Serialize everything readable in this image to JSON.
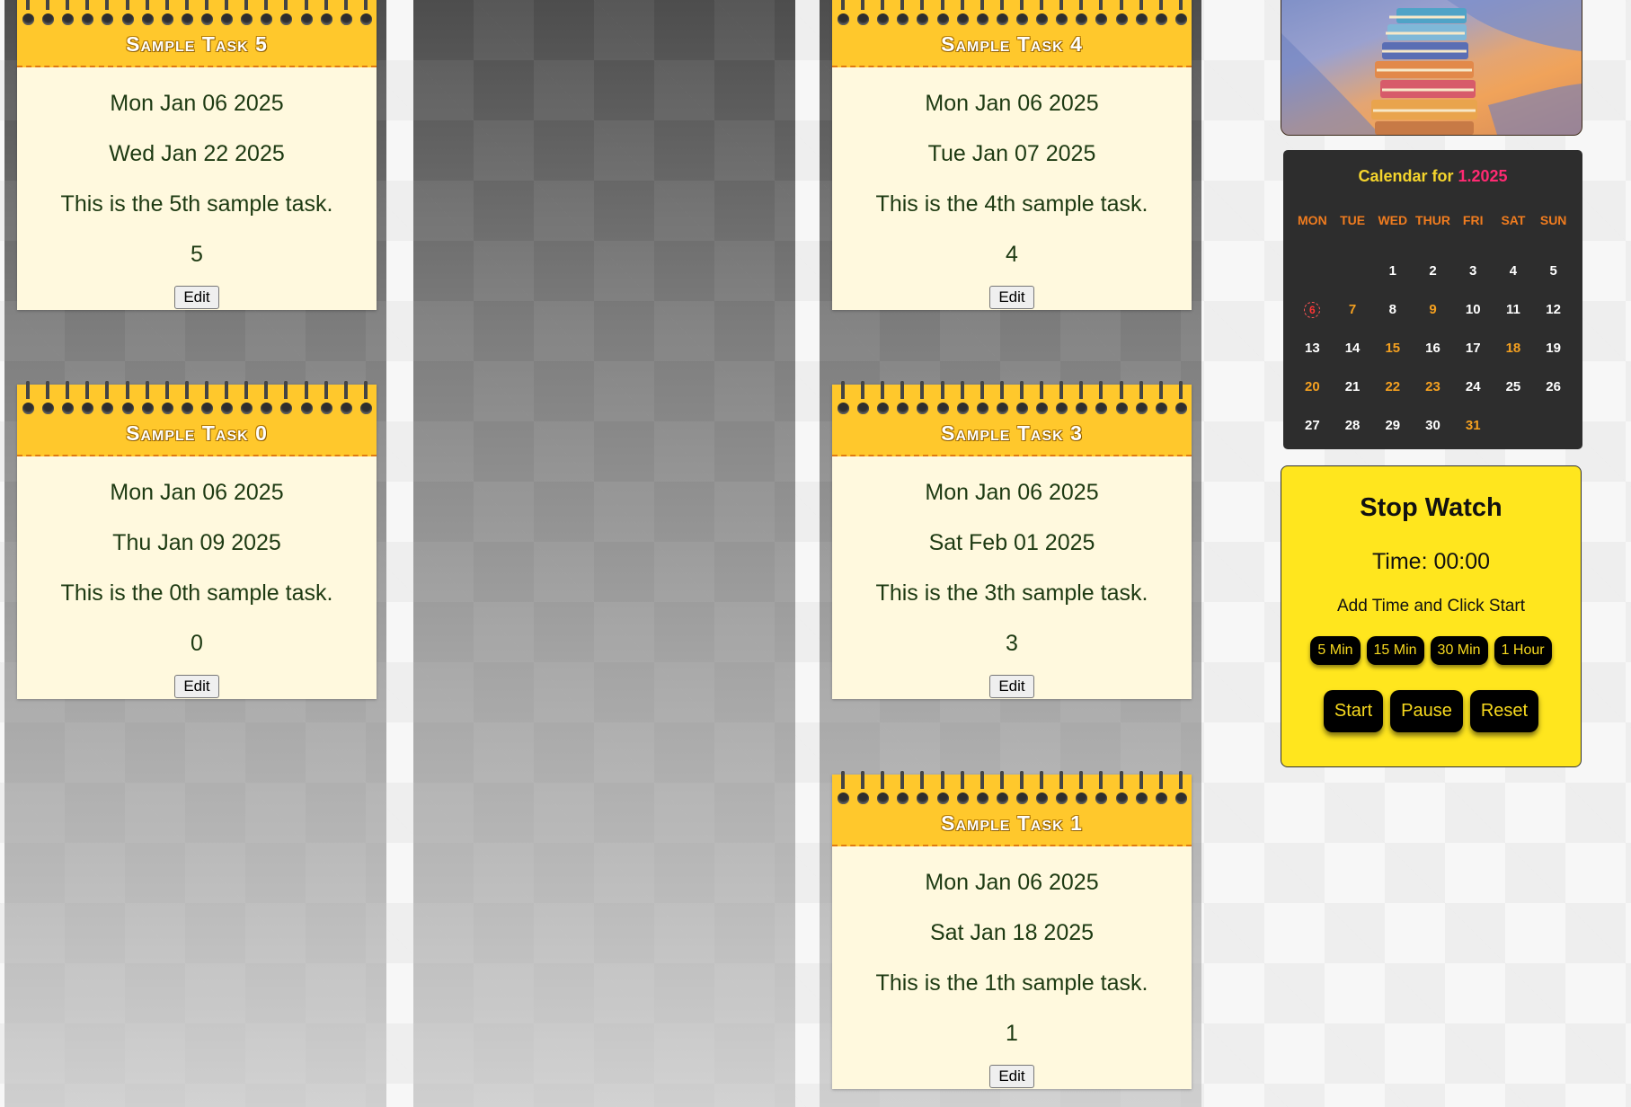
{
  "columns": {
    "left": {
      "tasks": [
        {
          "title": "Sample Task 5",
          "start": "Mon Jan 06 2025",
          "due": "Wed Jan 22 2025",
          "description": "This is the 5th sample task.",
          "number": "5",
          "edit_label": "Edit"
        },
        {
          "title": "Sample Task 0",
          "start": "Mon Jan 06 2025",
          "due": "Thu Jan 09 2025",
          "description": "This is the 0th sample task.",
          "number": "0",
          "edit_label": "Edit"
        }
      ]
    },
    "middle": {
      "tasks": []
    },
    "right": {
      "tasks": [
        {
          "title": "Sample Task 4",
          "start": "Mon Jan 06 2025",
          "due": "Tue Jan 07 2025",
          "description": "This is the 4th sample task.",
          "number": "4",
          "edit_label": "Edit"
        },
        {
          "title": "Sample Task 3",
          "start": "Mon Jan 06 2025",
          "due": "Sat Feb 01 2025",
          "description": "This is the 3th sample task.",
          "number": "3",
          "edit_label": "Edit"
        },
        {
          "title": "Sample Task 1",
          "start": "Mon Jan 06 2025",
          "due": "Sat Jan 18 2025",
          "description": "This is the 1th sample task.",
          "number": "1",
          "edit_label": "Edit"
        }
      ]
    }
  },
  "sidebar": {
    "image": {
      "icon": "books-stack-illustration"
    },
    "calendar": {
      "title_prefix": "Calendar for ",
      "title_date": "1.2025",
      "weekdays": [
        "MON",
        "TUE",
        "WED",
        "THUR",
        "FRI",
        "SAT",
        "SUN"
      ],
      "days": [
        "1",
        "2",
        "3",
        "4",
        "5",
        "6",
        "7",
        "8",
        "9",
        "10",
        "11",
        "12",
        "13",
        "14",
        "15",
        "16",
        "17",
        "18",
        "19",
        "20",
        "21",
        "22",
        "23",
        "24",
        "25",
        "26",
        "27",
        "28",
        "29",
        "30",
        "31"
      ],
      "today": "6",
      "highlighted_days": [
        "7",
        "9",
        "15",
        "18",
        "20",
        "22",
        "23",
        "31"
      ],
      "colors": {
        "background": "#2d2d2d",
        "weekday": "#f07c1f",
        "highlight": "#f4a020",
        "title": "#f5d52d",
        "title_accent": "#ff2a72",
        "today": "#ff3333"
      }
    },
    "stopwatch": {
      "title": "Stop Watch",
      "time_text": "Time: 00:00",
      "hint": "Add Time and Click Start",
      "add_buttons": [
        "5 Min",
        "15 Min",
        "30 Min",
        "1 Hour"
      ],
      "start_label": "Start",
      "pause_label": "Pause",
      "reset_label": "Reset",
      "colors": {
        "background": "#ffe61e",
        "button": "#000000",
        "button_text": "#f7d91e"
      }
    }
  },
  "colors": {
    "card_header": "#ffc82c",
    "card_body": "#fff9de",
    "card_text": "#1d3a12"
  }
}
